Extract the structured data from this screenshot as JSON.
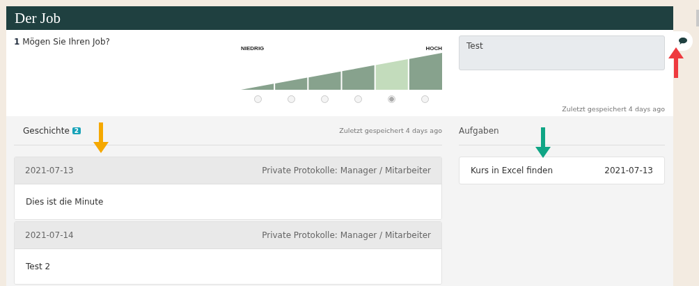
{
  "header": {
    "title": "Der Job"
  },
  "question": {
    "number": "1",
    "text": "Mögen Sie Ihren Job?",
    "low_label": "NIEDRIG",
    "high_label": "HOCH",
    "options": [
      {
        "selected": false
      },
      {
        "selected": false
      },
      {
        "selected": false
      },
      {
        "selected": false
      },
      {
        "selected": true
      },
      {
        "selected": false
      }
    ],
    "comment": {
      "value": "Test"
    },
    "saved": "Zuletzt gespeichert 4 days ago"
  },
  "history": {
    "tab": "Geschichte",
    "count": "2",
    "saved": "Zuletzt gespeichert 4 days ago",
    "entries": [
      {
        "date": "2021-07-13",
        "visibility": "Private Protokolle: Manager / Mitarbeiter",
        "text": "Dies ist die Minute"
      },
      {
        "date": "2021-07-14",
        "visibility": "Private Protokolle: Manager / Mitarbeiter",
        "text": "Test 2"
      }
    ]
  },
  "tasks": {
    "title": "Aufgaben",
    "items": [
      {
        "name": "Kurs in Excel finden",
        "date": "2021-07-13"
      }
    ]
  },
  "annotations": [
    {
      "kind": "up_arrow",
      "color": "#ee3a3f"
    },
    {
      "kind": "down_arrow",
      "color": "#f5a800"
    },
    {
      "kind": "down_arrow",
      "color": "#10a585"
    }
  ]
}
